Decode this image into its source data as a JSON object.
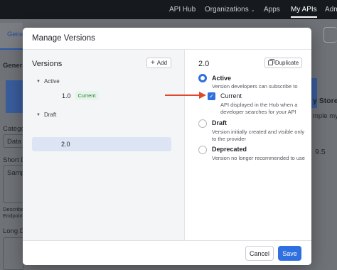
{
  "topnav": {
    "items": [
      "API Hub",
      "Organizations",
      "Apps",
      "My APIs",
      "Adm"
    ],
    "organizations_caret": "chevron-down"
  },
  "background": {
    "tab_label": "Gene",
    "section_label": "Genera",
    "category_label": "Catego",
    "category_value": "Data",
    "short_desc_label": "Short De",
    "short_desc_value": "Samp",
    "describe_text": "Describe",
    "endpoint_text": "Endpoint",
    "long_desc_label": "Long De",
    "right_store_text": "y Store",
    "right_sample_text": "mple my",
    "right_rating": "9.5"
  },
  "modal": {
    "title": "Manage Versions",
    "left": {
      "title": "Versions",
      "add_label": "Add",
      "groups": [
        {
          "label": "Active",
          "versions": [
            {
              "label": "1.0",
              "badge": "Current"
            }
          ]
        },
        {
          "label": "Draft",
          "versions": [
            {
              "label": "2.0"
            }
          ]
        }
      ]
    },
    "right": {
      "version_title": "2.0",
      "duplicate_label": "Duplicate",
      "options": [
        {
          "label": "Active",
          "description": "Version developers can subscribe to",
          "checked": true
        },
        {
          "label": "Draft",
          "description": "Version initially created and visible only to the provider",
          "checked": false
        },
        {
          "label": "Deprecated",
          "description": "Version no longer recommended to use",
          "checked": false
        }
      ],
      "current_checkbox": {
        "label": "Current",
        "description": "API displayed in the Hub when a developer searches for your API",
        "checked": true
      }
    },
    "footer": {
      "cancel_label": "Cancel",
      "save_label": "Save"
    }
  },
  "colors": {
    "accent": "#2f6fe0",
    "arrow": "#e0482c",
    "badge_bg": "#e6f4ea",
    "badge_text": "#2d7a3e",
    "selected_row": "#dde5f4"
  }
}
